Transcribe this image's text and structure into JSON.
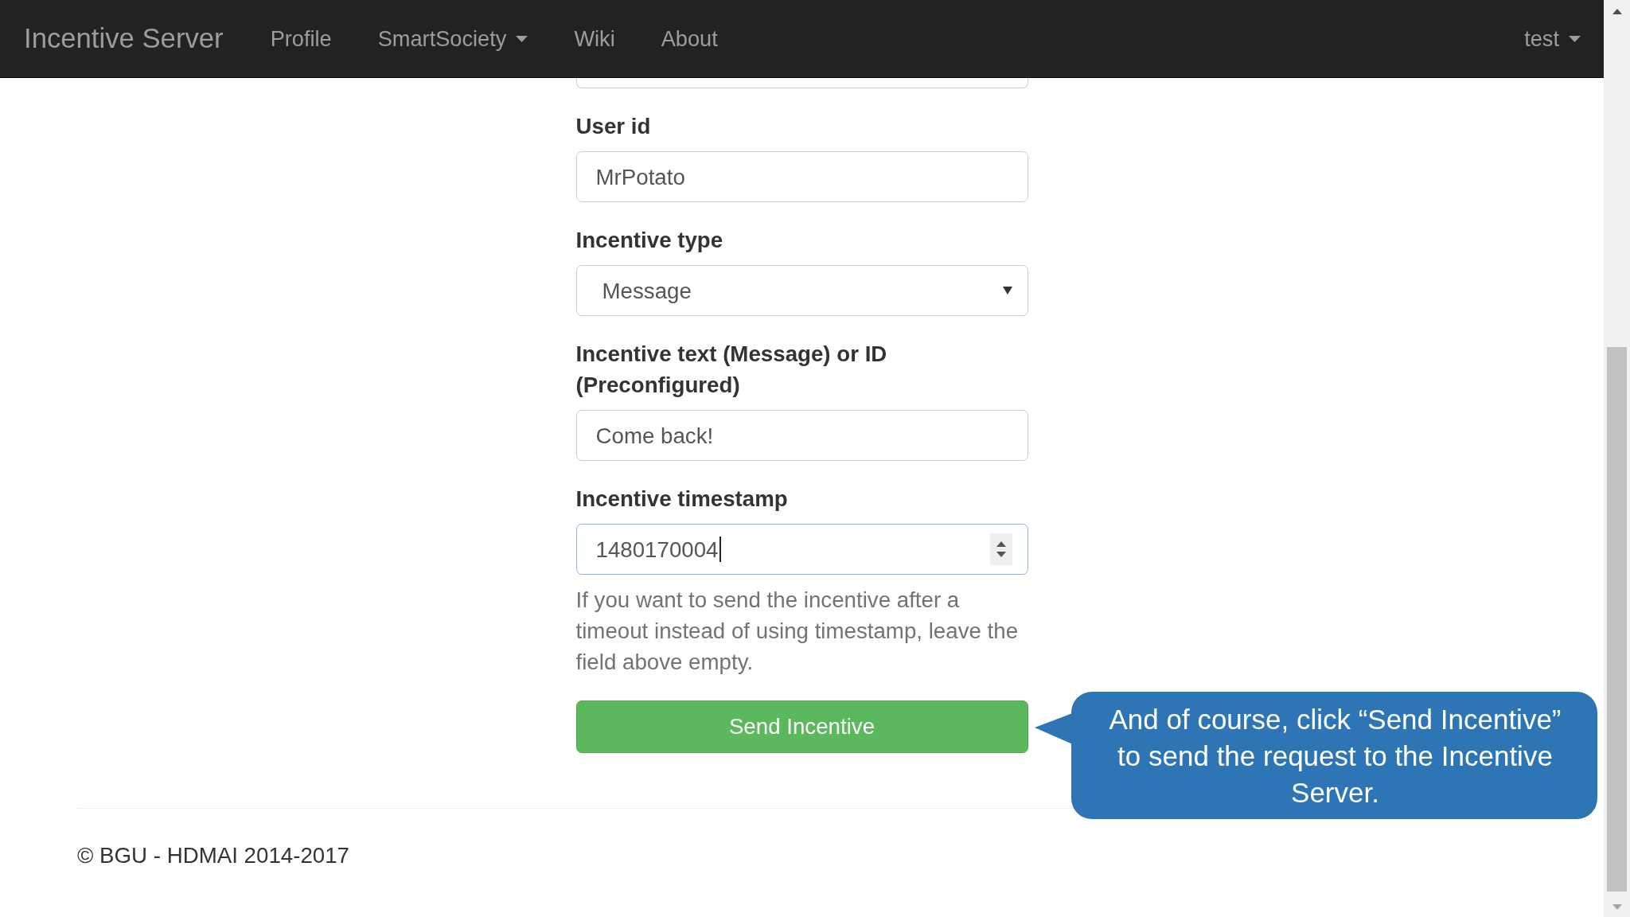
{
  "navbar": {
    "brand": "Incentive Server",
    "links": [
      {
        "label": "Profile",
        "dropdown": false
      },
      {
        "label": "SmartSociety",
        "dropdown": true
      },
      {
        "label": "Wiki",
        "dropdown": false
      },
      {
        "label": "About",
        "dropdown": false
      }
    ],
    "user_menu": {
      "label": "test",
      "dropdown": true
    }
  },
  "form": {
    "fields": [
      {
        "kind": "clipped"
      },
      {
        "kind": "text",
        "label": "User id",
        "value": "MrPotato",
        "focused": false
      },
      {
        "kind": "select",
        "label": "Incentive type",
        "value": "Message",
        "focused": false
      },
      {
        "kind": "text",
        "label": "Incentive text (Message) or ID (Preconfigured)",
        "value": "Come back!",
        "focused": false
      },
      {
        "kind": "number",
        "label": "Incentive timestamp",
        "value": "1480170004",
        "focused": true,
        "help": "If you want to send the incentive after a timeout instead of using timestamp, leave the field above empty."
      }
    ],
    "submit_button": "Send Incentive"
  },
  "footer": {
    "copyright": "© BGU - HDMAI 2014-2017"
  },
  "callout": {
    "text": "And of course, click “Send Incentive” to send the request to the Incentive Server."
  }
}
